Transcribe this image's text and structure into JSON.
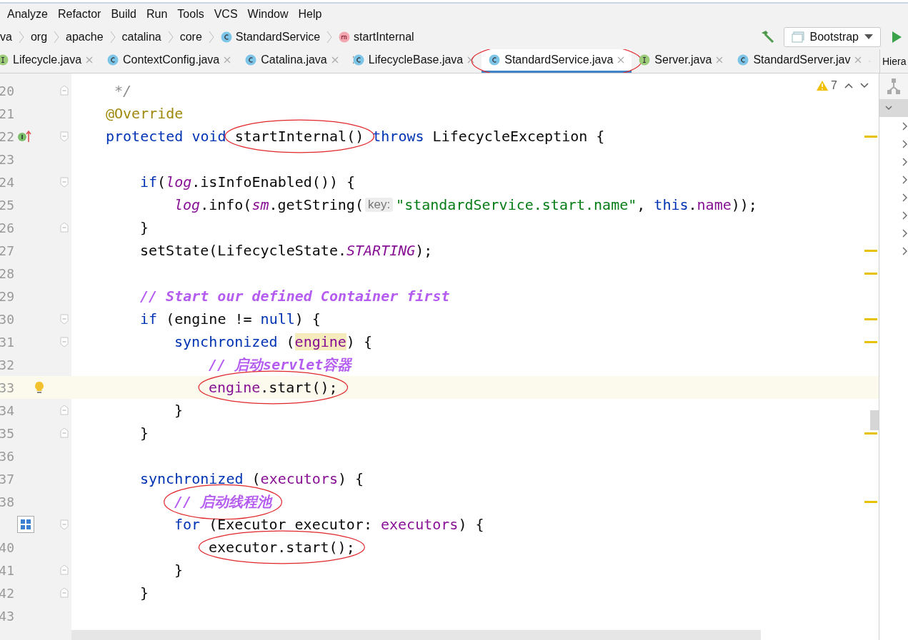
{
  "menu": [
    "Analyze",
    "Refactor",
    "Build",
    "Run",
    "Tools",
    "VCS",
    "Window",
    "Help"
  ],
  "breadcrumbs": [
    {
      "label": "va"
    },
    {
      "label": "org"
    },
    {
      "label": "apache"
    },
    {
      "label": "catalina"
    },
    {
      "label": "core"
    },
    {
      "label": "StandardService",
      "kind": "class"
    },
    {
      "label": "startInternal",
      "kind": "method"
    }
  ],
  "run_config": {
    "label": "Bootstrap"
  },
  "tabs": [
    {
      "label": "Lifecycle.java",
      "kind": "interface",
      "selected": false,
      "circled": false
    },
    {
      "label": "ContextConfig.java",
      "kind": "class",
      "selected": false,
      "circled": false
    },
    {
      "label": "Catalina.java",
      "kind": "class",
      "selected": false,
      "circled": false
    },
    {
      "label": "LifecycleBase.java",
      "kind": "abstract",
      "selected": false,
      "circled": false
    },
    {
      "label": "StandardService.java",
      "kind": "class",
      "selected": true,
      "circled": true
    },
    {
      "label": "Server.java",
      "kind": "interface",
      "selected": false,
      "circled": false
    },
    {
      "label": "StandardServer.jav",
      "kind": "class",
      "selected": false,
      "circled": false
    }
  ],
  "side_panel": {
    "title": "Hiera",
    "rows": [
      {
        "expanded": true
      },
      {
        "expanded": false
      },
      {
        "expanded": false
      },
      {
        "expanded": false
      },
      {
        "expanded": false
      },
      {
        "expanded": false
      },
      {
        "expanded": false
      },
      {
        "expanded": false
      },
      {
        "expanded": false
      }
    ]
  },
  "inspections": {
    "warnings": "7"
  },
  "lines": [
    {
      "number": "20",
      "fold_end": true,
      "tokens": [
        {
          "kind": "doc",
          "text": " */"
        }
      ]
    },
    {
      "number": "21",
      "tokens": [
        {
          "kind": "annotation",
          "text": "@Override"
        }
      ]
    },
    {
      "number": "22",
      "fold_start": true,
      "implemented": true,
      "warning": true,
      "tokens": [
        {
          "kind": "keyword",
          "text": "protected void "
        },
        {
          "kind": "circled",
          "tokens": [
            {
              "kind": "plain",
              "text": "startInternal()"
            }
          ]
        },
        {
          "kind": "keyword",
          "text": " throws"
        },
        {
          "kind": "plain",
          "text": " LifecycleException {"
        }
      ],
      "children": [
        {
          "number": "23"
        },
        {
          "number": "24",
          "fold_start": true,
          "tokens": [
            {
              "kind": "keyword",
              "text": "if"
            },
            {
              "kind": "plain",
              "text": "("
            },
            {
              "kind": "static",
              "text": "log"
            },
            {
              "kind": "plain",
              "text": ".isInfoEnabled()) {"
            }
          ],
          "children": [
            {
              "number": "25",
              "tokens": [
                {
                  "kind": "static",
                  "text": "log"
                },
                {
                  "kind": "plain",
                  "text": ".info("
                },
                {
                  "kind": "static",
                  "text": "sm"
                },
                {
                  "kind": "plain",
                  "text": ".getString("
                },
                {
                  "kind": "hint",
                  "text": "key:"
                },
                {
                  "kind": "string",
                  "text": "\"standardService.start.name\""
                },
                {
                  "kind": "plain",
                  "text": ", "
                },
                {
                  "kind": "keyword",
                  "text": "this"
                },
                {
                  "kind": "plain",
                  "text": "."
                },
                {
                  "kind": "field",
                  "text": "name"
                },
                {
                  "kind": "plain",
                  "text": "));"
                }
              ]
            }
          ]
        },
        {
          "number": "26",
          "fold_end": true,
          "tokens": [
            {
              "kind": "plain",
              "text": "}"
            }
          ]
        },
        {
          "number": "27",
          "warning": true,
          "tokens": [
            {
              "kind": "plain",
              "text": "setState(LifecycleState."
            },
            {
              "kind": "constant",
              "text": "STARTING"
            },
            {
              "kind": "plain",
              "text": ");"
            }
          ]
        },
        {
          "number": "28",
          "warning": true
        },
        {
          "number": "29",
          "tokens": [
            {
              "kind": "comment",
              "text": "// Start our defined Container first"
            }
          ]
        },
        {
          "number": "30",
          "fold_start": true,
          "warning": true,
          "tokens": [
            {
              "kind": "keyword",
              "text": "if"
            },
            {
              "kind": "plain",
              "text": " (engine != "
            },
            {
              "kind": "keyword",
              "text": "null"
            },
            {
              "kind": "plain",
              "text": ") {"
            }
          ],
          "children": [
            {
              "number": "31",
              "fold_start": true,
              "warning": true,
              "tokens": [
                {
                  "kind": "keyword",
                  "text": "synchronized"
                },
                {
                  "kind": "plain",
                  "text": " ("
                },
                {
                  "kind": "highlight",
                  "text": "engine"
                },
                {
                  "kind": "plain",
                  "text": ") {"
                }
              ],
              "children": [
                {
                  "number": "32",
                  "tokens": [
                    {
                      "kind": "comment",
                      "text": "// 启动servlet容器"
                    }
                  ]
                },
                {
                  "number": "33",
                  "current": true,
                  "bulb": true,
                  "tokens": [
                    {
                      "kind": "circled",
                      "tokens": [
                        {
                          "kind": "field",
                          "text": "engine"
                        },
                        {
                          "kind": "plain",
                          "text": ".start();"
                        }
                      ]
                    }
                  ]
                }
              ]
            },
            {
              "number": "34",
              "fold_end": true,
              "tokens": [
                {
                  "kind": "plain",
                  "text": "}"
                }
              ]
            }
          ]
        },
        {
          "number": "35",
          "fold_end": true,
          "warning": true,
          "tokens": [
            {
              "kind": "plain",
              "text": "}"
            }
          ]
        },
        {
          "number": "36"
        },
        {
          "number": "37",
          "tokens": [
            {
              "kind": "keyword",
              "text": "synchronized"
            },
            {
              "kind": "plain",
              "text": " ("
            },
            {
              "kind": "field",
              "text": "executors"
            },
            {
              "kind": "plain",
              "text": ") {"
            }
          ],
          "children": [
            {
              "number": "38",
              "warning": true,
              "tokens": [
                {
                  "kind": "circled",
                  "tokens": [
                    {
                      "kind": "comment",
                      "text": "// 启动线程池"
                    }
                  ]
                }
              ]
            },
            {
              "fold_start": true,
              "layout_preview": true,
              "tokens": [
                {
                  "kind": "keyword",
                  "text": "for"
                },
                {
                  "kind": "plain",
                  "text": " (Executor executor: "
                },
                {
                  "kind": "field",
                  "text": "executors"
                },
                {
                  "kind": "plain",
                  "text": ") {"
                }
              ],
              "children": [
                {
                  "number": "40",
                  "tokens": [
                    {
                      "kind": "circled",
                      "tokens": [
                        {
                          "kind": "plain",
                          "text": "executor.start();"
                        }
                      ]
                    }
                  ]
                }
              ]
            },
            {
              "number": "41",
              "fold_end": true,
              "tokens": [
                {
                  "kind": "plain",
                  "text": "}"
                }
              ]
            }
          ]
        },
        {
          "number": "42",
          "fold_end": true,
          "tokens": [
            {
              "kind": "plain",
              "text": "}"
            }
          ]
        },
        {
          "number": "43"
        }
      ]
    }
  ]
}
